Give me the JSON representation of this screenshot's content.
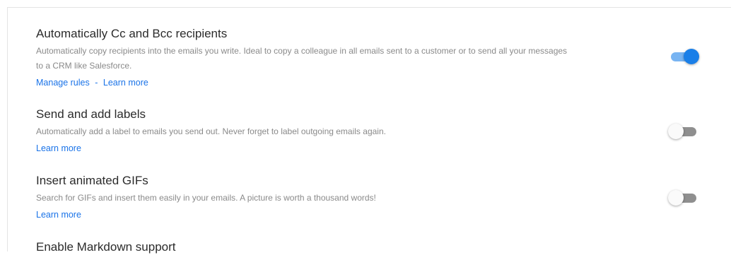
{
  "settings": [
    {
      "title": "Automatically Cc and Bcc recipients",
      "description": "Automatically copy recipients into the emails you write. Ideal to copy a colleague in all emails sent to a customer or to send all your messages to a CRM like Salesforce.",
      "links": [
        "Manage rules",
        "Learn more"
      ],
      "link_separator": "-",
      "enabled": true
    },
    {
      "title": "Send and add labels",
      "description": "Automatically add a label to emails you send out. Never forget to label outgoing emails again.",
      "links": [
        "Learn more"
      ],
      "enabled": false
    },
    {
      "title": "Insert animated GIFs",
      "description": "Search for GIFs and insert them easily in your emails. A picture is worth a thousand words!",
      "links": [
        "Learn more"
      ],
      "enabled": false
    },
    {
      "title": "Enable Markdown support"
    }
  ],
  "colors": {
    "link": "#1a73e8",
    "toggle_on_knob": "#1a7fe8",
    "toggle_on_track": "#78b4f2",
    "toggle_off_track": "#8f8f8f"
  }
}
